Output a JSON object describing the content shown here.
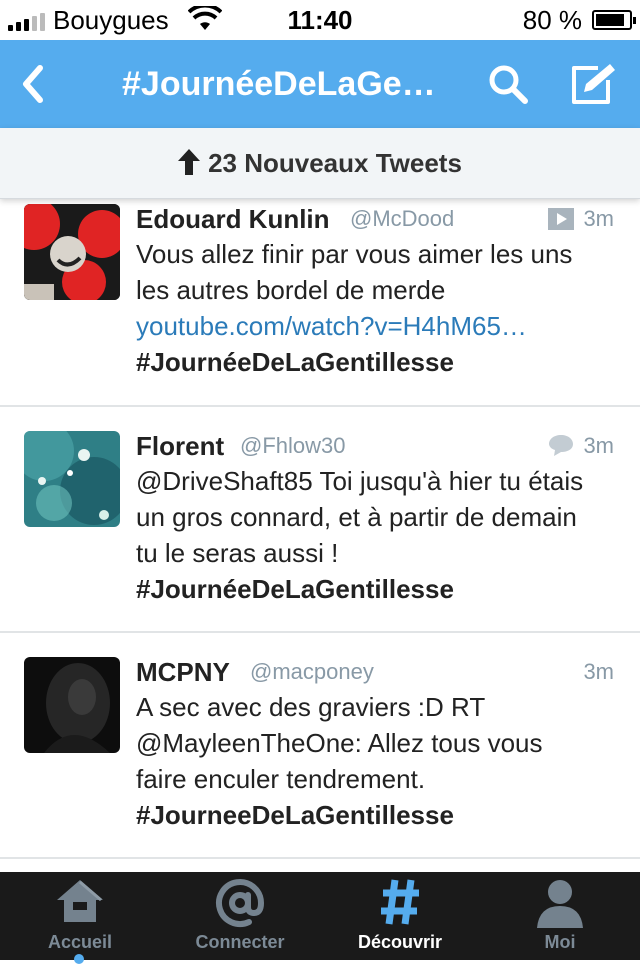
{
  "status_bar": {
    "carrier": "Bouygues",
    "time": "11:40",
    "battery": "80 %"
  },
  "navbar": {
    "title": "#JournéeDeLaGe…"
  },
  "new_tweets": {
    "label": "23 Nouveaux Tweets"
  },
  "tweets": [
    {
      "name": "Edouard Kunlin",
      "handle": "@McDood",
      "time": "3m",
      "meta_icon": "video-icon",
      "lines": [
        "Vous allez finir par vous aimer les uns",
        "les autres bordel de merde"
      ],
      "link": "youtube.com/watch?v=H4hM65…",
      "hashtag": "#JournéeDeLaGentillesse"
    },
    {
      "name": "Florent",
      "handle": "@Fhlow30",
      "time": "3m",
      "meta_icon": "conversation-icon",
      "lines": [
        "@DriveShaft85 Toi jusqu'à hier tu étais",
        "un gros connard, et à partir de demain",
        "tu le seras aussi !"
      ],
      "hashtag": "#JournéeDeLaGentillesse"
    },
    {
      "name": "MCPNY",
      "handle": "@macponey",
      "time": "3m",
      "lines": [
        "A sec avec des graviers :D RT",
        "@MayleenTheOne: Allez tous vous",
        "faire enculer tendrement."
      ],
      "hashtag": "#JourneeDeLaGentillesse"
    }
  ],
  "tabbar": {
    "tabs": [
      {
        "label": "Accueil",
        "icon": "home-icon"
      },
      {
        "label": "Connecter",
        "icon": "at-icon"
      },
      {
        "label": "Découvrir",
        "icon": "hashtag-icon"
      },
      {
        "label": "Moi",
        "icon": "profile-icon"
      }
    ],
    "active": "Découvrir"
  },
  "colors": {
    "accent": "#55acee",
    "link": "#2b7bb9",
    "tabbar": "#1a1a1a"
  }
}
